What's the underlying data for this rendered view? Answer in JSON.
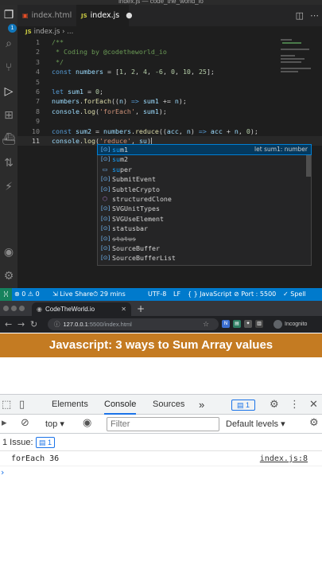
{
  "vscode": {
    "title": "index.js — code_the_world_io",
    "tabs": [
      {
        "label": "index.html",
        "icon": "html5-icon",
        "active": false
      },
      {
        "label": "index.js",
        "icon": "js-icon",
        "active": true,
        "dirty": true
      }
    ],
    "breadcrumb": {
      "file": "index.js",
      "sep": "› ..."
    },
    "code_lines": [
      "1",
      "2",
      "3",
      "4",
      "5",
      "6",
      "7",
      "8",
      "9",
      "10",
      "11"
    ],
    "suggestions": [
      {
        "label": "sum1",
        "match": "su",
        "rest": "m1",
        "icon": "variable-icon",
        "detail": "let sum1: number"
      },
      {
        "label": "sum2",
        "match": "su",
        "rest": "m2",
        "icon": "variable-icon"
      },
      {
        "label": "super",
        "match": "su",
        "rest": "per",
        "icon": "keyword-icon"
      },
      {
        "label": "SubmitEvent",
        "icon": "variable-icon"
      },
      {
        "label": "SubtleCrypto",
        "icon": "variable-icon"
      },
      {
        "label": "structuredClone",
        "icon": "function-icon"
      },
      {
        "label": "SVGUnitTypes",
        "icon": "variable-icon"
      },
      {
        "label": "SVGUseElement",
        "icon": "variable-icon"
      },
      {
        "label": "statusbar",
        "icon": "variable-icon"
      },
      {
        "label": "status",
        "icon": "variable-icon",
        "deprecated": true
      },
      {
        "label": "SourceBuffer",
        "icon": "variable-icon"
      },
      {
        "label": "SourceBufferList",
        "icon": "variable-icon"
      }
    ],
    "status": {
      "problems": "⊗ 0 ⚠ 0",
      "live_share": "Live Share",
      "time": "29 mins",
      "encoding": "UTF-8",
      "eol": "LF",
      "language": "{ } JavaScript",
      "port": "Port : 5500",
      "spell": "✓ Spell"
    }
  },
  "browser": {
    "tab_title": "CodeTheWorld.io",
    "url_host": "127.0.0.1",
    "url_rest": ":5500/index.html",
    "incognito": "Incognito"
  },
  "banner": {
    "text": "Javascript: 3 ways to Sum Array values"
  },
  "devtools": {
    "tabs": [
      "Elements",
      "Console",
      "Sources"
    ],
    "more": "»",
    "issue_count": "1",
    "context": "top ▾",
    "filter_placeholder": "Filter",
    "levels": "Default levels ▾",
    "issues_label": "1 Issue:",
    "issues_count": "1",
    "log": {
      "text": "forEach 36",
      "source": "index.js:8"
    },
    "prompt": "›"
  },
  "colors": {
    "accent": "#007acc",
    "banner": "#c47b22",
    "devtools_blue": "#1a73e8"
  }
}
